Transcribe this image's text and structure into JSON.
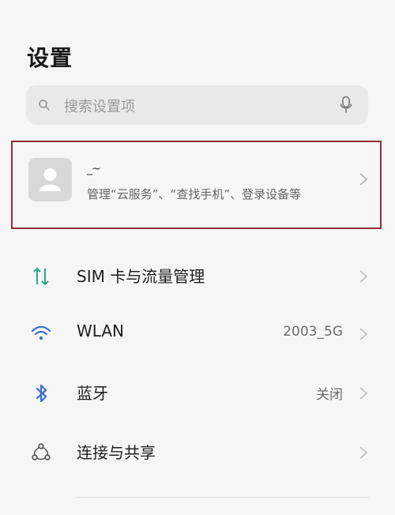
{
  "header": {
    "title": "设置"
  },
  "search": {
    "placeholder": "搜索设置项"
  },
  "account": {
    "name": "_~",
    "description": "管理“云服务”、“查找手机”、登录设备等"
  },
  "rows": [
    {
      "label": "SIM 卡与流量管理",
      "value": "",
      "icon": "sim-data-icon"
    },
    {
      "label": "WLAN",
      "value": "2003_5G",
      "icon": "wifi-icon"
    },
    {
      "label": "蓝牙",
      "value": "关闭",
      "icon": "bluetooth-icon"
    },
    {
      "label": "连接与共享",
      "value": "",
      "icon": "share-connection-icon"
    }
  ],
  "colors": {
    "sim_icon": "#2aa783",
    "wifi_icon": "#3c6fd1",
    "bluetooth_icon": "#3c6fd1",
    "share_icon": "#5b5b5b",
    "highlight_border": "#8e2f33"
  }
}
